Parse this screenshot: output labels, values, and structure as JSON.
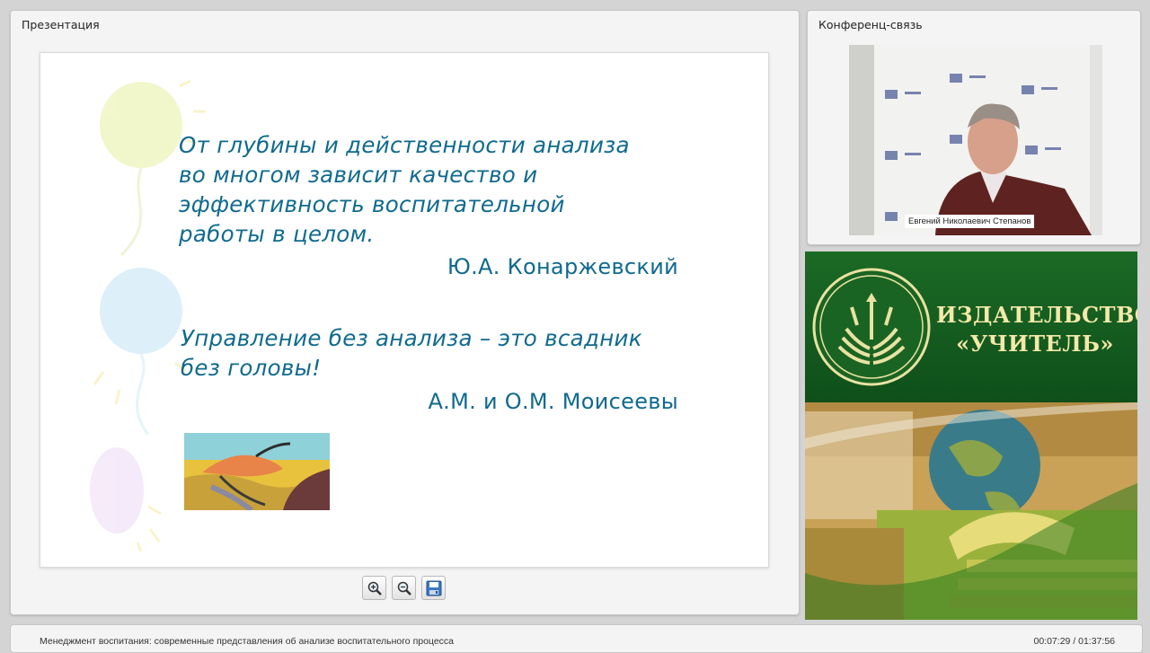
{
  "presentation": {
    "title": "Презентация",
    "slide": {
      "quote1": {
        "lines": [
          "От глубины и действенности анализа",
          "во многом зависит качество и",
          "эффективность воспитательной",
          "работы в целом."
        ],
        "author": "Ю.А. Конаржевский"
      },
      "quote2": {
        "lines": [
          "Управление без анализа – это всадник",
          "без головы!"
        ],
        "author": "А.М. и О.М. Моисеевы"
      }
    },
    "toolbar": {
      "zoom_in_icon": "zoom-in-icon",
      "zoom_out_icon": "zoom-out-icon",
      "save_icon": "floppy-disk-icon"
    }
  },
  "conference": {
    "title": "Конференц-связь",
    "speaker_name": "Евгений Николаевич Степанов"
  },
  "ad": {
    "line1": "ИЗДАТЕЛЬСТВО",
    "line2": "«УЧИТЕЛЬ»"
  },
  "footer": {
    "lecture_title": "Менеджмент воспитания: современные представления об анализе воспитательного процесса",
    "time": "00:07:29 / 01:37:56"
  },
  "colors": {
    "quote_text": "#0f6a8e",
    "ad_green": "#13581e",
    "ad_text": "#f3e9a8"
  }
}
